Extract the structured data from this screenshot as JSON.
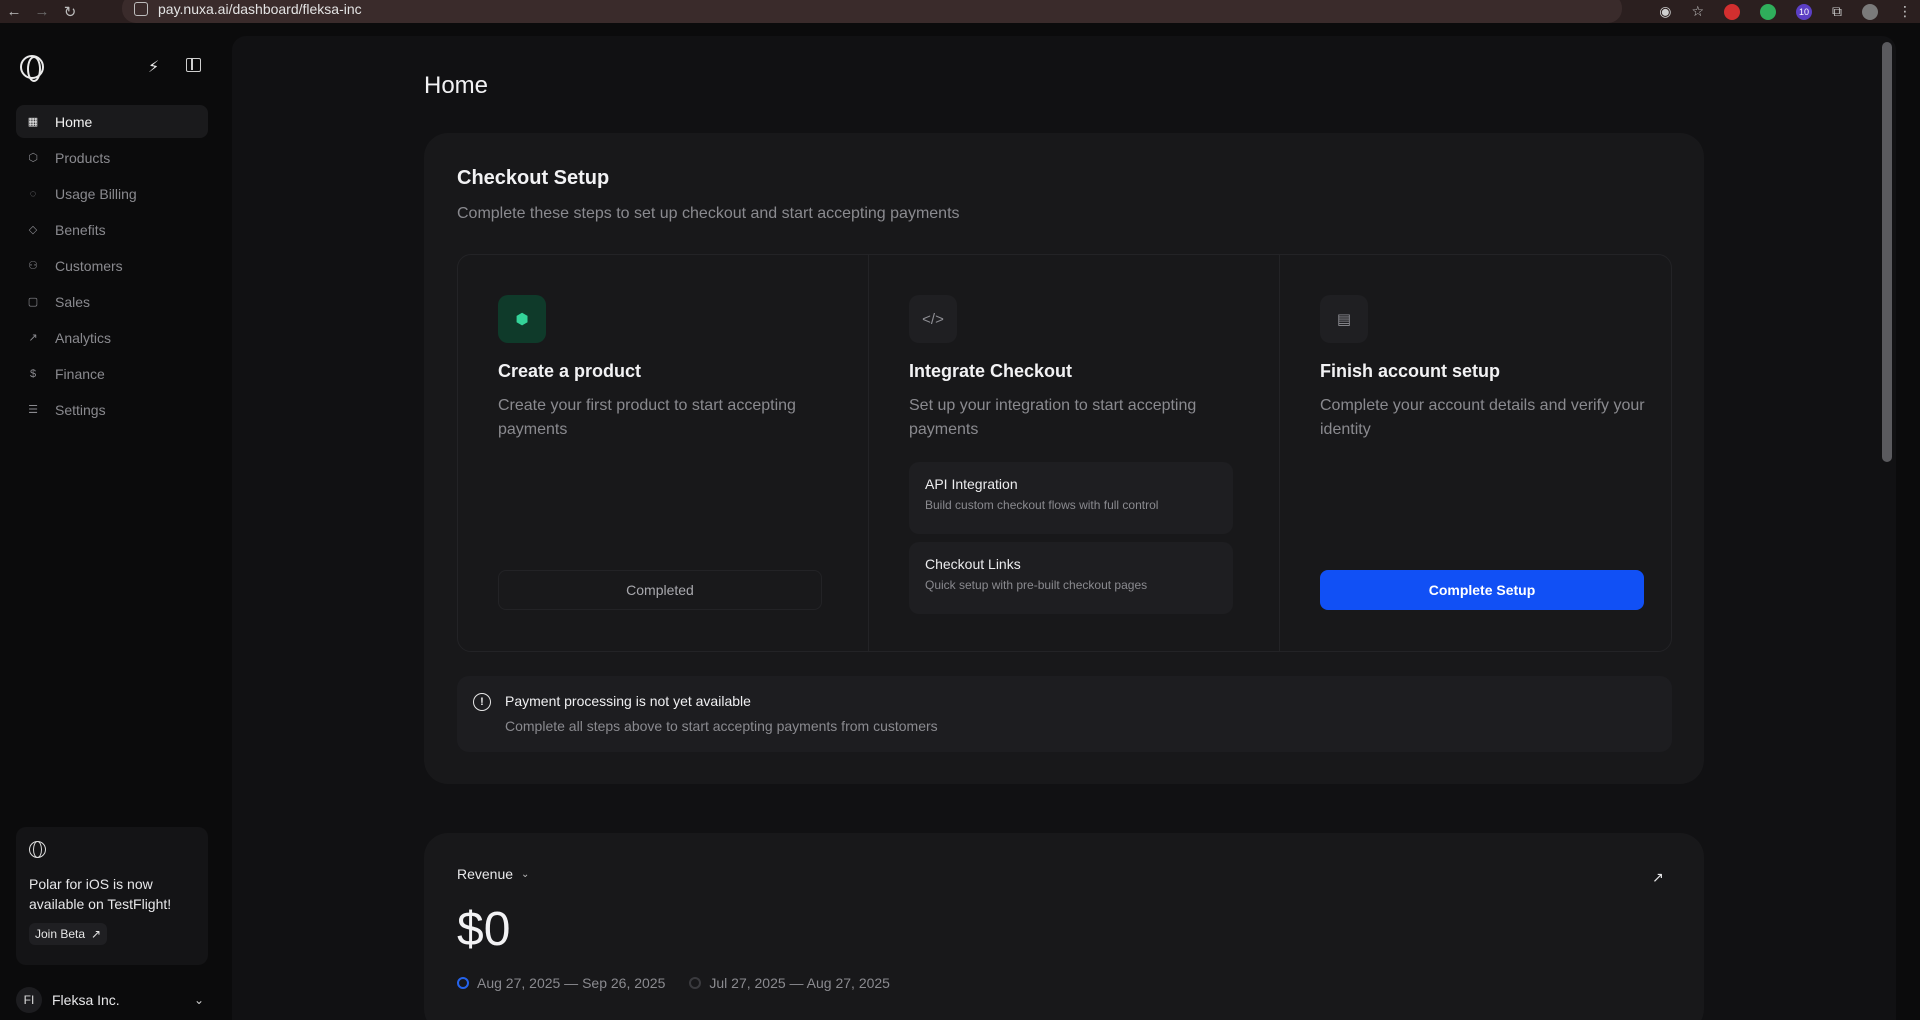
{
  "browser": {
    "url": "pay.nuxa.ai/dashboard/fleksa-inc",
    "extension_badge": "10"
  },
  "sidebar": {
    "items": [
      {
        "label": "Home",
        "icon": "grid-icon"
      },
      {
        "label": "Products",
        "icon": "hexagon-icon"
      },
      {
        "label": "Usage Billing",
        "icon": "refresh-icon"
      },
      {
        "label": "Benefits",
        "icon": "diamond-icon"
      },
      {
        "label": "Customers",
        "icon": "users-icon"
      },
      {
        "label": "Sales",
        "icon": "bag-icon"
      },
      {
        "label": "Analytics",
        "icon": "trend-icon"
      },
      {
        "label": "Finance",
        "icon": "dollar-icon"
      },
      {
        "label": "Settings",
        "icon": "sliders-icon"
      }
    ],
    "promo": {
      "text": "Polar for iOS is now available on TestFlight!",
      "button": "Join Beta"
    },
    "org": {
      "initials": "FI",
      "name": "Fleksa Inc."
    }
  },
  "main": {
    "title": "Home",
    "checkout": {
      "title": "Checkout Setup",
      "subtitle": "Complete these steps to set up checkout and start accepting payments",
      "steps": [
        {
          "title": "Create a product",
          "desc": "Create your first product to start accepting payments",
          "action": "Completed"
        },
        {
          "title": "Integrate Checkout",
          "desc": "Set up your integration to start accepting payments",
          "options": [
            {
              "title": "API Integration",
              "desc": "Build custom checkout flows with full control"
            },
            {
              "title": "Checkout Links",
              "desc": "Quick setup with pre-built checkout pages"
            }
          ]
        },
        {
          "title": "Finish account setup",
          "desc": "Complete your account details and verify your identity",
          "action": "Complete Setup"
        }
      ],
      "notice": {
        "title": "Payment processing is not yet available",
        "desc": "Complete all steps above to start accepting payments from customers"
      }
    },
    "revenue": {
      "label": "Revenue",
      "value": "$0",
      "periods": [
        "Aug 27, 2025 — Sep 26, 2025",
        "Jul 27, 2025 — Aug 27, 2025"
      ]
    }
  },
  "colors": {
    "accent": "#1150f5",
    "success": "#34d399"
  }
}
